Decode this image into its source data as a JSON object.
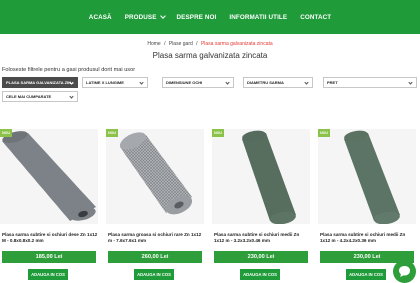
{
  "nav": {
    "items": [
      {
        "label": "ACASĂ",
        "dropdown": false
      },
      {
        "label": "PRODUSE",
        "dropdown": true
      },
      {
        "label": "DESPRE NOI",
        "dropdown": false
      },
      {
        "label": "INFORMATII UTILE",
        "dropdown": false
      },
      {
        "label": "CONTACT",
        "dropdown": false
      }
    ],
    "color": "#1f9b3a"
  },
  "breadcrumb": {
    "home": "Home",
    "sep1": "/",
    "category": "Plase gard",
    "sep2": "/",
    "current": "Plasa sarma galvanizata zincata"
  },
  "page_title": "Plasa sarma galvanizata zincata",
  "filters": {
    "intro": "Foloseste filtrele pentru a gasi produsul dorit mai usor",
    "items": [
      {
        "label": "PLASA SARMA GALVANIZATA ZIN...",
        "active": true
      },
      {
        "label": "LATIME X LUNGIME",
        "active": false
      },
      {
        "label": "DIMENSIUNE OCHI",
        "active": false
      },
      {
        "label": "DIAMETRU SARMA",
        "active": false
      },
      {
        "label": "PRET",
        "active": false
      },
      {
        "label": "CELE MAI CUMPARATE",
        "active": false
      }
    ]
  },
  "products": [
    {
      "badge": "NOU",
      "title": "Plasa sarma subtire si ochiuri dese Zn 1x12 M - 0.8x0.8x0.2 mm",
      "price": "185,00 Lei",
      "button": "ADAUGA IN COS"
    },
    {
      "badge": "NOU",
      "title": "Plasa sarma groasa si ochiuri rare Zn 1x12 m - 7.6x7.6x1 mm",
      "price": "260,00 Lei",
      "button": "ADAUGA IN COS"
    },
    {
      "badge": "NOU",
      "title": "Plasa sarma subtire si ochiuri medii Zn 1x12 m - 3.2x3.2x0.46 mm",
      "price": "230,00 Lei",
      "button": "ADAUGA IN COS"
    },
    {
      "badge": "NOU",
      "title": "Plasa sarma subtire si ochiuri medii Zn 1x12 m - 4.2x4.2x0.36 mm",
      "price": "230,00 Lei",
      "button": "ADAUGA IN COS"
    }
  ],
  "chat": {
    "icon": "chat-bubble-icon"
  }
}
